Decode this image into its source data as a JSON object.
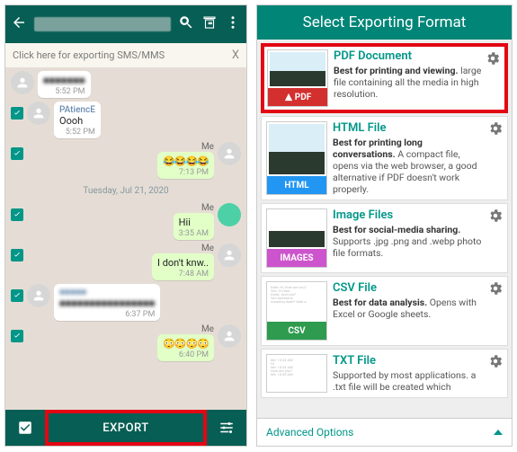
{
  "left": {
    "banner": "Click here for exporting SMS/MMS",
    "date_separator": "Tuesday, Jul 21, 2020",
    "export_label": "EXPORT",
    "messages": {
      "m1_sender": "",
      "m1_time": "5:52 PM",
      "m2_sender": "PAtiencE",
      "m2_body": "Oooh",
      "m2_time": "5:52 PM",
      "m3_label": "Me",
      "m3_body": "😂😂😂😂",
      "m3_time": "7:13 PM",
      "m4_label": "Me",
      "m4_body": "Hii",
      "m4_time": "3:35 AM",
      "m5_label": "Me",
      "m5_body": "I don't knw..",
      "m5_time": "7:48 AM",
      "m6_time": "6:37 PM",
      "m7_label": "Me",
      "m7_body": "😳😳😳😳",
      "m7_time": "6:40 PM"
    }
  },
  "right": {
    "header": "Select Exporting Format",
    "advanced": "Advanced Options",
    "formats": {
      "pdf_title": "PDF Document",
      "pdf_strong": "Best for printing and viewing.",
      "pdf_rest": " large file containing all the media in high resolution.",
      "pdf_tag": "PDF",
      "html_title": "HTML File",
      "html_strong": "Best for printing long conversations.",
      "html_rest": " A compact file, opens via the web browser, a good alternative if PDF doesn't work properly.",
      "html_tag": "HTML",
      "img_title": "Image Files",
      "img_strong": "Best for social-media sharing.",
      "img_rest": " Supports .jpg .png and .webp photo file formats.",
      "img_tag": "IMAGES",
      "csv_title": "CSV File",
      "csv_strong": "Best for data analysis.",
      "csv_rest": " Opens with Excel or Google sheets.",
      "csv_tag": "CSV",
      "txt_title": "TXT File",
      "txt_strong": "",
      "txt_rest": "Supported by most applications. a .txt file will be created which"
    }
  }
}
